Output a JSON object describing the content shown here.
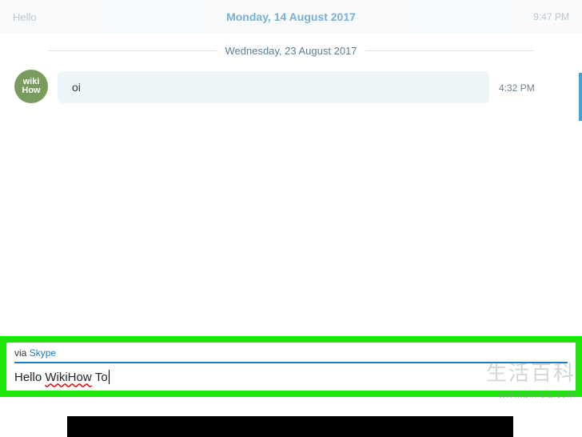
{
  "header": {
    "left_hello": "Hello",
    "center_date": "Monday, 14 August 2017",
    "right_time": "9:47 PM"
  },
  "divider_date": "Wednesday, 23 August 2017",
  "avatar": {
    "line1": "wiki",
    "line2": "How"
  },
  "message": {
    "text": "oi",
    "time": "4:32 PM"
  },
  "compose": {
    "via_prefix": "via ",
    "via_link": "Skype",
    "text_plain_prefix": "Hello ",
    "text_spell_1": "WikiHow",
    "text_space": " ",
    "text_plain_suffix": "To"
  },
  "watermark": {
    "cn": "生活百科",
    "url": "www.bimeiz.com"
  }
}
